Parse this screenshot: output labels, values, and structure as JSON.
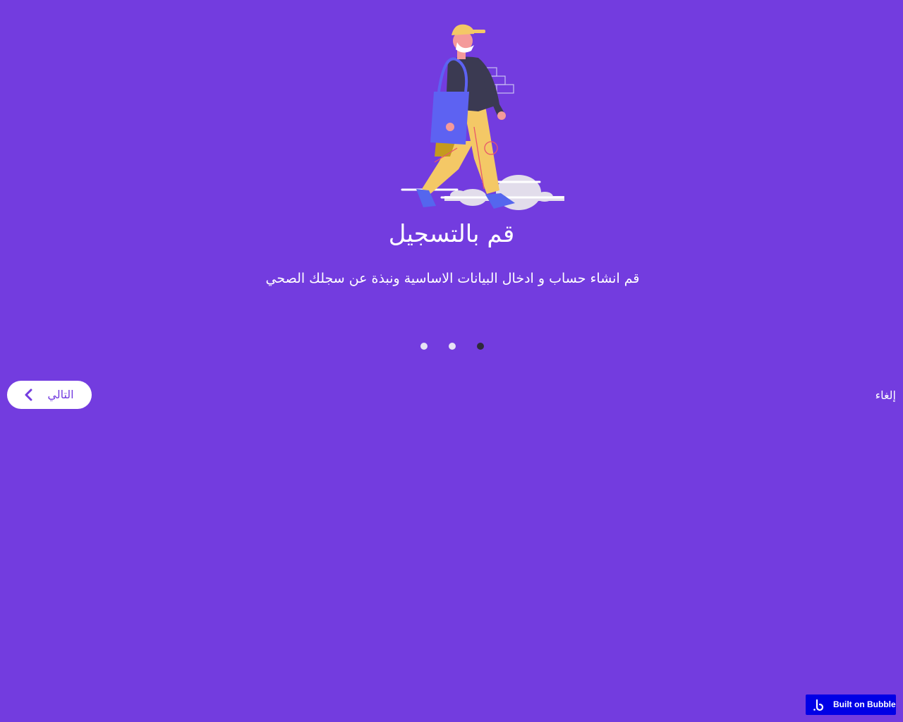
{
  "onboarding": {
    "title": "قم بالتسجيل",
    "subtitle": "قم انشاء حساب و ادخال البيانات الاساسية ونبذة عن سجلك الصحي",
    "illustration_icon": "walking-person-illustration",
    "pagination": {
      "total": 3,
      "active_index": 3
    }
  },
  "actions": {
    "next_label": "التالي",
    "next_icon": "chevron-left-icon",
    "cancel_label": "إلغاء"
  },
  "badge": {
    "label": "Built on Bubble",
    "icon": "bubble-logo-icon"
  },
  "colors": {
    "background": "#733CDF",
    "button_bg": "#FFFFFF",
    "accent_text": "#733CDF",
    "dot_inactive": "#E6E2F4",
    "dot_active": "#2E2A3A",
    "badge_bg": "#0000E6"
  }
}
